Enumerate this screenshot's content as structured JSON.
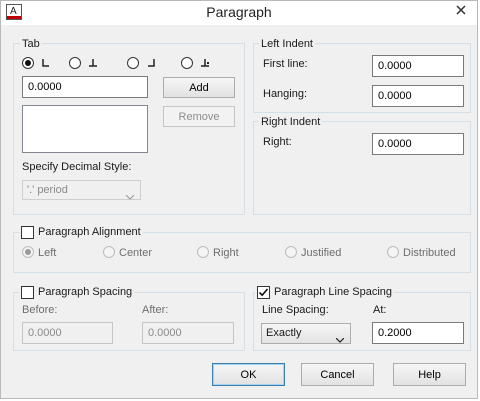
{
  "window": {
    "title": "Paragraph"
  },
  "tab": {
    "legend": "Tab",
    "position_value": "0.0000",
    "add_label": "Add",
    "remove_label": "Remove",
    "decimal_style_label": "Specify Decimal Style:",
    "decimal_style_value": "'.' period",
    "tab_types": [
      "left-tab",
      "center-tab",
      "right-tab",
      "decimal-tab"
    ],
    "selected_tab_type": "left-tab"
  },
  "left_indent": {
    "legend": "Left Indent",
    "first_line_label": "First line:",
    "first_line_value": "0.0000",
    "hanging_label": "Hanging:",
    "hanging_value": "0.0000"
  },
  "right_indent": {
    "legend": "Right Indent",
    "right_label": "Right:",
    "right_value": "0.0000"
  },
  "alignment": {
    "legend": "Paragraph Alignment",
    "checked": false,
    "options": [
      "Left",
      "Center",
      "Right",
      "Justified",
      "Distributed"
    ],
    "selected": "Left"
  },
  "spacing": {
    "legend": "Paragraph Spacing",
    "checked": false,
    "before_label": "Before:",
    "before_value": "0.0000",
    "after_label": "After:",
    "after_value": "0.0000"
  },
  "line_spacing": {
    "legend": "Paragraph Line Spacing",
    "checked": true,
    "type_label": "Line Spacing:",
    "type_value": "Exactly",
    "at_label": "At:",
    "at_value": "0.2000"
  },
  "footer": {
    "ok_label": "OK",
    "cancel_label": "Cancel",
    "help_label": "Help"
  },
  "colors": {
    "accent": "#3c7fb1",
    "close_red": "#c42b1c",
    "icon_red": "#c00000"
  }
}
